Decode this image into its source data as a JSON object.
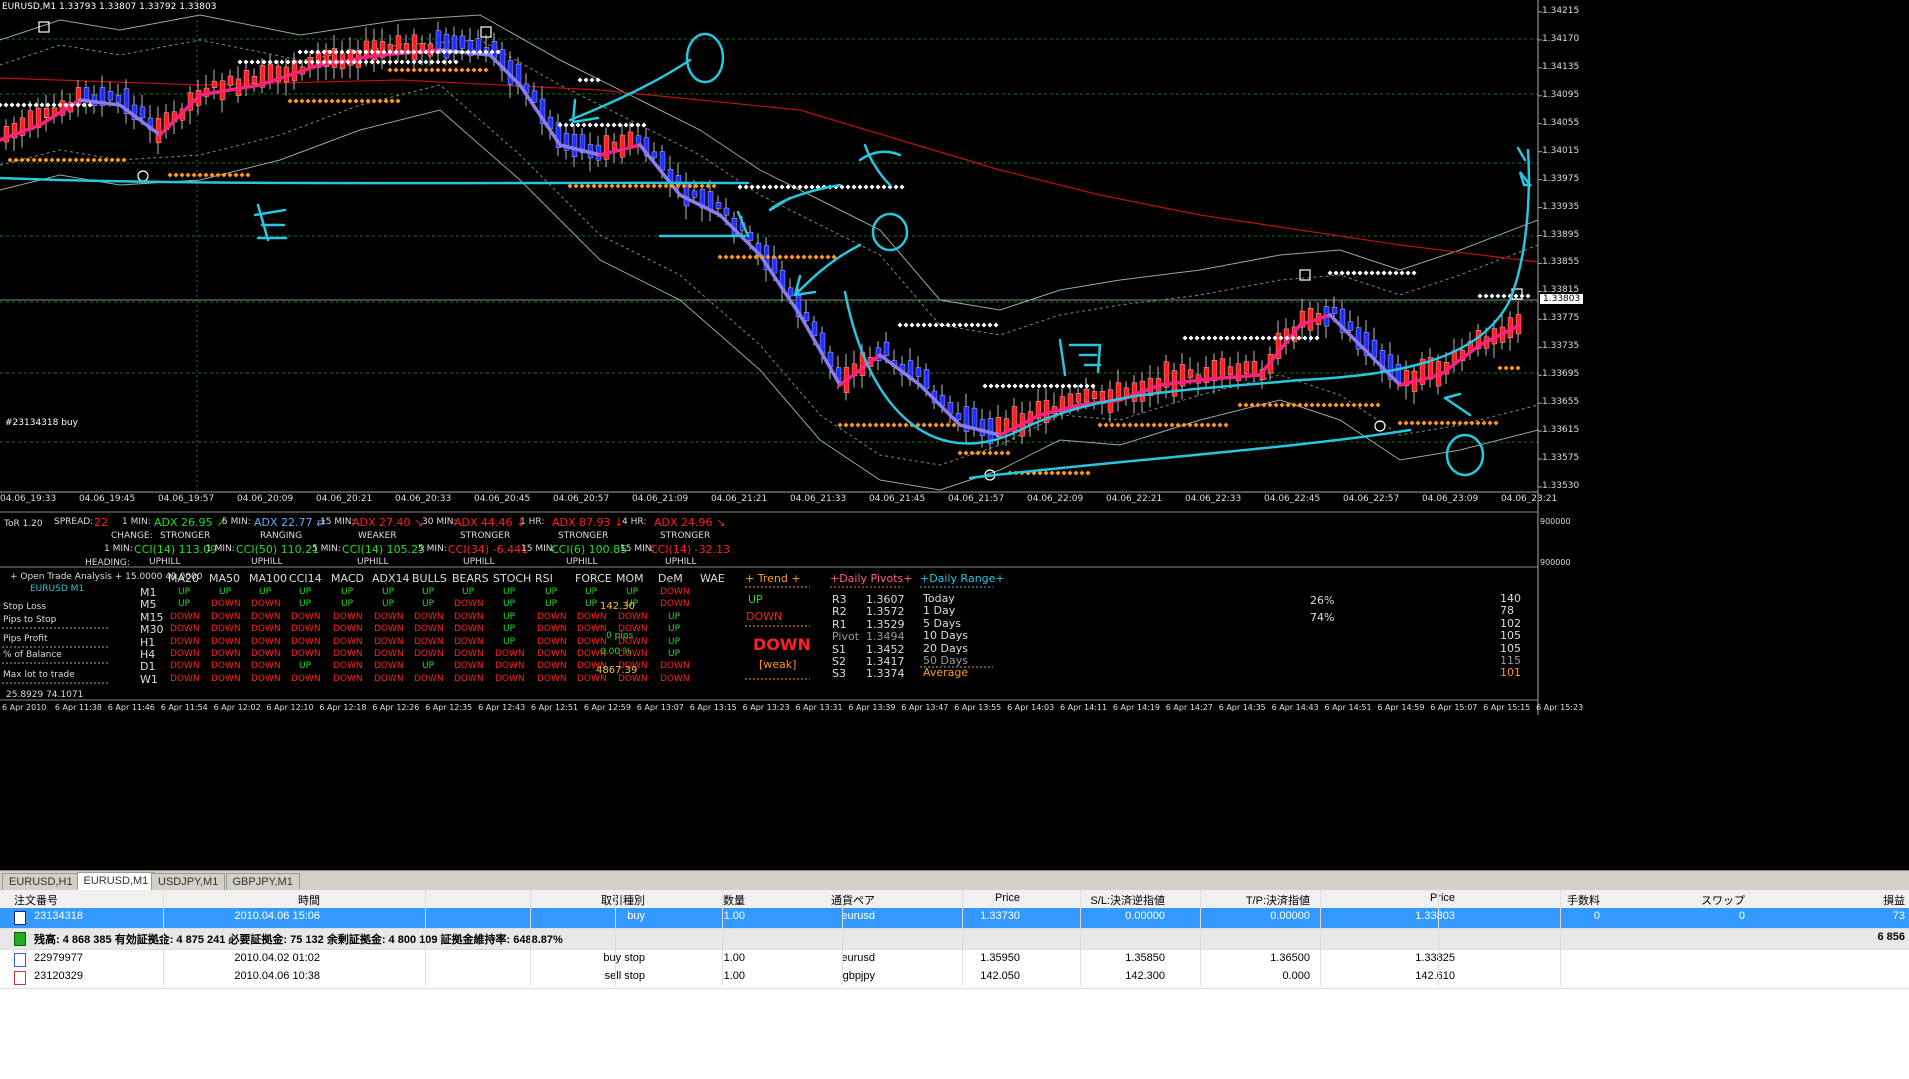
{
  "chart": {
    "symbol_info": "EURUSD,M1  1.33793 1.33807 1.33792 1.33803",
    "trade_label": "#23134318 buy",
    "price_ticks": [
      "1.34215",
      "1.34170",
      "1.34135",
      "1.34095",
      "1.34055",
      "1.34015",
      "1.33975",
      "1.33935",
      "1.33895",
      "1.33855",
      "1.33815",
      "1.33775",
      "1.33735",
      "1.33695",
      "1.33655",
      "1.33615",
      "1.33575",
      "1.33530"
    ],
    "current_price": "1.33803",
    "time_ticks": [
      "04.06_19:33",
      "04.06_19:45",
      "04.06_19:57",
      "04.06_20:09",
      "04.06_20:21",
      "04.06_20:33",
      "04.06_20:45",
      "04.06_20:57",
      "04.06_21:09",
      "04.06_21:21",
      "04.06_21:33",
      "04.06_21:45",
      "04.06_21:57",
      "04.06_22:09",
      "04.06_22:21",
      "04.06_22:33",
      "04.06_22:45",
      "04.06_22:57",
      "04.06_23:09",
      "04.06_23:21"
    ],
    "colors": {
      "bull": "#ff2020",
      "bear": "#2030ff",
      "ma_pink": "#ff2080",
      "ma_violet": "#8a7cf0",
      "ma_red": "#c01010",
      "cyan": "#29c6e0",
      "dots_white": "#ffffff",
      "dots_orange": "#ff9a1a"
    }
  },
  "tor": {
    "name": "ToR 1.20",
    "spread_label": "SPREAD:",
    "spread": "22",
    "adx": [
      {
        "tf": "1 MIN:",
        "val": "ADX 26.95",
        "arrow": "↗",
        "state": "STRONGER",
        "color": "#1ee01e"
      },
      {
        "tf": "5 MIN:",
        "val": "ADX 22.77",
        "arrow": "⇄",
        "state": "RANGING",
        "color": "#5ab0ff"
      },
      {
        "tf": "15 MIN:",
        "val": "ADX 27.40",
        "arrow": "↘",
        "state": "WEAKER",
        "color": "#ff2020"
      },
      {
        "tf": "30 MIN:",
        "val": "ADX 44.46",
        "arrow": "↓",
        "state": "STRONGER",
        "color": "#ff2020"
      },
      {
        "tf": "1 HR:",
        "val": "ADX 87.93",
        "arrow": "↓",
        "state": "STRONGER",
        "color": "#ff2020"
      },
      {
        "tf": "4 HR:",
        "val": "ADX 24.96",
        "arrow": "↘",
        "state": "STRONGER",
        "color": "#ff2020"
      }
    ],
    "change_label": "CHANGE:",
    "heading_label": "HEADING:",
    "cci": [
      {
        "tf": "1 MIN:",
        "val": "CCI(14) 113.09",
        "state": "UPHILL",
        "color": "#1ee01e"
      },
      {
        "tf": "1 MIN:",
        "val": "CCI(50) 110.21",
        "state": "UPHILL",
        "color": "#1ee01e"
      },
      {
        "tf": "5 MIN:",
        "val": "CCI(14) 105.23",
        "state": "UPHILL",
        "color": "#1ee01e"
      },
      {
        "tf": "5 MIN:",
        "val": "CCI(34) -6.441",
        "state": "UPHILL",
        "color": "#ff2020"
      },
      {
        "tf": "15 MIN:",
        "val": "CCI(6) 100.85",
        "state": "UPHILL",
        "color": "#1ee01e"
      },
      {
        "tf": "15 MIN:",
        "val": "CCI(14) -32.13",
        "state": "UPHILL",
        "color": "#ff2020"
      }
    ],
    "right_ticks": [
      "900000",
      "900000",
      "0"
    ]
  },
  "analysis": {
    "title": "+ Open Trade Analysis + 15.0000 49.0000",
    "pair": "EURUSD  M1",
    "left_labels": [
      "Stop Loss",
      "Pips to Stop",
      "Pips Profit",
      "% of Balance",
      "Max lot to trade"
    ],
    "columns": [
      "MA20",
      "MA50",
      "MA100",
      "CCI14",
      "MACD",
      "ADX14",
      "BULLS",
      "BEARS",
      "STOCH",
      "RSI",
      "FORCE",
      "MOM",
      "DeM",
      "WAE"
    ],
    "timeframes": [
      "M1",
      "M5",
      "M15",
      "M30",
      "H1",
      "H4",
      "D1",
      "W1"
    ],
    "grid": [
      [
        "UP",
        "UP",
        "UP",
        "UP",
        "UP",
        "UP",
        "UP",
        "UP",
        "UP",
        "UP",
        "UP",
        "UP",
        "DOWN"
      ],
      [
        "UP",
        "DOWN",
        "DOWN",
        "UP",
        "UP",
        "UP",
        "UP",
        "DOWN",
        "UP",
        "UP",
        "UP",
        "UP",
        "DOWN"
      ],
      [
        "DOWN",
        "DOWN",
        "DOWN",
        "DOWN",
        "DOWN",
        "DOWN",
        "DOWN",
        "DOWN",
        "UP",
        "DOWN",
        "DOWN",
        "DOWN",
        "UP"
      ],
      [
        "DOWN",
        "DOWN",
        "DOWN",
        "DOWN",
        "DOWN",
        "DOWN",
        "DOWN",
        "DOWN",
        "UP",
        "DOWN",
        "DOWN",
        "DOWN",
        "UP"
      ],
      [
        "DOWN",
        "DOWN",
        "DOWN",
        "DOWN",
        "DOWN",
        "DOWN",
        "DOWN",
        "DOWN",
        "UP",
        "DOWN",
        "DOWN",
        "DOWN",
        "UP"
      ],
      [
        "DOWN",
        "DOWN",
        "DOWN",
        "DOWN",
        "DOWN",
        "DOWN",
        "DOWN",
        "DOWN",
        "DOWN",
        "DOWN",
        "DOWN",
        "DOWN",
        "UP"
      ],
      [
        "DOWN",
        "DOWN",
        "DOWN",
        "UP",
        "DOWN",
        "DOWN",
        "UP",
        "DOWN",
        "DOWN",
        "DOWN",
        "DOWN",
        "DOWN",
        "DOWN"
      ],
      [
        "DOWN",
        "DOWN",
        "DOWN",
        "DOWN",
        "DOWN",
        "DOWN",
        "DOWN",
        "DOWN",
        "DOWN",
        "DOWN",
        "DOWN",
        "DOWN",
        "DOWN"
      ]
    ],
    "overlay": [
      "142.30",
      "0 pips",
      "0.00 %",
      "4867.39"
    ],
    "bottom": "25.8929 74.1071",
    "trend_title": "+ Trend +",
    "trend_up": "UP",
    "trend_down": "DOWN",
    "trend_big": "DOWN",
    "trend_weak": "[weak]",
    "pivots_title": "+Daily Pivots+",
    "pivots": [
      [
        "R3",
        "1.3607"
      ],
      [
        "R2",
        "1.3572"
      ],
      [
        "R1",
        "1.3529"
      ],
      [
        "Pivot",
        "1.3494"
      ],
      [
        "S1",
        "1.3452"
      ],
      [
        "S2",
        "1.3417"
      ],
      [
        "S3",
        "1.3374"
      ]
    ],
    "range_title": "+Daily Range+",
    "ranges": [
      [
        "Today",
        "140"
      ],
      [
        "1 Day",
        "78"
      ],
      [
        "5 Days",
        "102"
      ],
      [
        "10 Days",
        "105"
      ],
      [
        "20 Days",
        "105"
      ],
      [
        "50 Days",
        "115"
      ],
      [
        "Average",
        "101"
      ]
    ],
    "pct": [
      "26%",
      "74%"
    ]
  },
  "lower_axis": [
    "6 Apr 2010",
    "6 Apr 11:38",
    "6 Apr 11:46",
    "6 Apr 11:54",
    "6 Apr 12:02",
    "6 Apr 12:10",
    "6 Apr 12:18",
    "6 Apr 12:26",
    "6 Apr 12:35",
    "6 Apr 12:43",
    "6 Apr 12:51",
    "6 Apr 12:59",
    "6 Apr 13:07",
    "6 Apr 13:15",
    "6 Apr 13:23",
    "6 Apr 13:31",
    "6 Apr 13:39",
    "6 Apr 13:47",
    "6 Apr 13:55",
    "6 Apr 14:03",
    "6 Apr 14:11",
    "6 Apr 14:19",
    "6 Apr 14:27",
    "6 Apr 14:35",
    "6 Apr 14:43",
    "6 Apr 14:51",
    "6 Apr 14:59",
    "6 Apr 15:07",
    "6 Apr 15:15",
    "6 Apr 15:23"
  ],
  "tabs": [
    "EURUSD,H1",
    "EURUSD,M1",
    "USDJPY,M1",
    "GBPJPY,M1"
  ],
  "terminal": {
    "headers": [
      "注文番号",
      "時間",
      "取引種別",
      "数量",
      "通貨ペア",
      "Price",
      "S/L:決済逆指値",
      "T/P:決済指値",
      "Price",
      "手数料",
      "スワップ",
      "損益"
    ],
    "trade": [
      "23134318",
      "2010.04.06 15:06",
      "buy",
      "1.00",
      "eurusd",
      "1.33730",
      "0.00000",
      "0.00000",
      "1.33803",
      "0",
      "0",
      "73"
    ],
    "balance": "残高: 4 868 385  有効証拠金: 4 875 241  必要証拠金: 75 132  余剰証拠金: 4 800 109  証拠金維持率: 6488.87%",
    "balance_pl": "6 856",
    "orders": [
      [
        "22979977",
        "2010.04.02 01:02",
        "buy stop",
        "1.00",
        "eurusd",
        "1.35950",
        "1.35850",
        "1.36500",
        "1.33825"
      ],
      [
        "23120329",
        "2010.04.06 10:38",
        "sell stop",
        "1.00",
        "gbpjpy",
        "142.050",
        "142.300",
        "0.000",
        "142.610"
      ]
    ]
  }
}
